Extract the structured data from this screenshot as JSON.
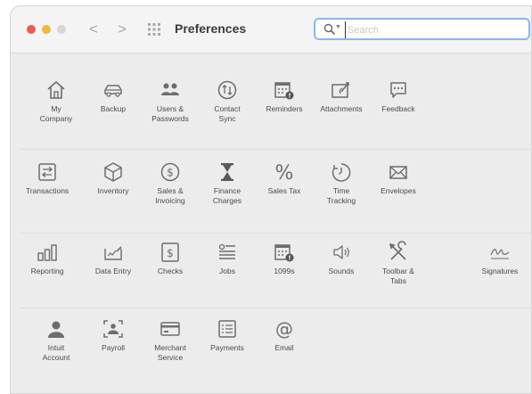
{
  "window": {
    "title": "Preferences"
  },
  "toolbar": {
    "back_glyph": "<",
    "forward_glyph": ">",
    "grid_icon": "grid-icon"
  },
  "search": {
    "placeholder": "Search",
    "value": ""
  },
  "rows": [
    [
      {
        "id": "my-company",
        "label": "My\nCompany",
        "icon": "house-icon"
      },
      {
        "id": "backup",
        "label": "Backup",
        "icon": "car-icon"
      },
      {
        "id": "users-passwords",
        "label": "Users &\nPasswords",
        "icon": "users-icon"
      },
      {
        "id": "contact-sync",
        "label": "Contact\nSync",
        "icon": "sync-icon"
      },
      {
        "id": "reminders",
        "label": "Reminders",
        "icon": "calendar-alert-icon"
      },
      {
        "id": "attachments",
        "label": "Attachments",
        "icon": "attachment-icon"
      },
      {
        "id": "feedback",
        "label": "Feedback",
        "icon": "chat-bubble-icon"
      }
    ],
    [
      {
        "id": "transactions",
        "label": "Transactions",
        "icon": "transactions-icon"
      },
      {
        "id": "inventory",
        "label": "Inventory",
        "icon": "box-icon"
      },
      {
        "id": "sales-invoicing",
        "label": "Sales &\nInvoicing",
        "icon": "dollar-circle-icon"
      },
      {
        "id": "finance-charges",
        "label": "Finance\nCharges",
        "icon": "hourglass-icon"
      },
      {
        "id": "sales-tax",
        "label": "Sales Tax",
        "icon": "percent-icon"
      },
      {
        "id": "time-tracking",
        "label": "Time\nTracking",
        "icon": "stopwatch-icon"
      },
      {
        "id": "envelopes",
        "label": "Envelopes",
        "icon": "envelope-icon"
      }
    ],
    [
      {
        "id": "reporting",
        "label": "Reporting",
        "icon": "bar-chart-icon"
      },
      {
        "id": "data-entry",
        "label": "Data Entry",
        "icon": "data-entry-icon"
      },
      {
        "id": "checks",
        "label": "Checks",
        "icon": "dollar-square-icon"
      },
      {
        "id": "jobs",
        "label": "Jobs",
        "icon": "list-icon"
      },
      {
        "id": "1099s",
        "label": "1099s",
        "icon": "calendar-alert-icon"
      },
      {
        "id": "sounds",
        "label": "Sounds",
        "icon": "speaker-icon"
      },
      {
        "id": "toolbar-tabs",
        "label": "Toolbar &\nTabs",
        "icon": "tools-icon"
      },
      {
        "id": "signatures",
        "label": "Signatures",
        "icon": "signature-icon"
      }
    ],
    [
      {
        "id": "intuit-account",
        "label": "Intuit\nAccount",
        "icon": "person-icon"
      },
      {
        "id": "payroll",
        "label": "Payroll",
        "icon": "payroll-icon"
      },
      {
        "id": "merchant-service",
        "label": "Merchant\nService",
        "icon": "card-icon"
      },
      {
        "id": "payments",
        "label": "Payments",
        "icon": "receipt-icon"
      },
      {
        "id": "email",
        "label": "Email",
        "icon": "at-sign-icon"
      }
    ]
  ]
}
